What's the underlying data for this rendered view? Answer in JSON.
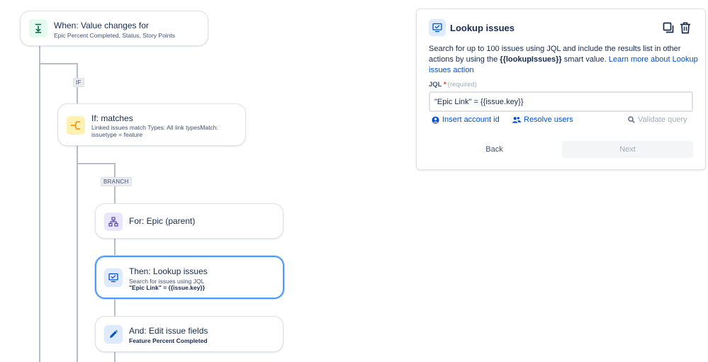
{
  "flow": {
    "trigger": {
      "title": "When: Value changes for",
      "subtitle": "Epic Percent Completed, Status, Story Points",
      "icon": "trigger-down-arrow-icon"
    },
    "if_tag": "IF",
    "condition": {
      "title": "If: matches",
      "subtitle": "Linked issues match Types: All link typesMatch: issuetype = feature",
      "icon": "branch-icon"
    },
    "branch_tag": "BRANCH",
    "branch": {
      "title": "For: Epic (parent)",
      "icon": "hierarchy-icon"
    },
    "lookup": {
      "title": "Then: Lookup issues",
      "subtitle": "Search for issues using JQL",
      "subtitle_bold": "\"Epic Link\" = {{issue.key}}",
      "icon": "lookup-icon"
    },
    "edit": {
      "title": "And: Edit issue fields",
      "subtitle_bold": "Feature Percent Completed",
      "icon": "pencil-icon"
    }
  },
  "panel": {
    "title": "Lookup issues",
    "desc_before": "Search for up to 100 issues using JQL and include the results list in other actions by using the ",
    "desc_smart_value": "{{lookupIssues}}",
    "desc_after": " smart value. ",
    "desc_link": "Learn more about Lookup issues action",
    "jql_label": "JQL",
    "jql_required_mark": "*",
    "jql_hint": "(required)",
    "jql_value": "\"Epic Link\" = {{issue.key}}",
    "insert_account": "Insert account id",
    "resolve_users": "Resolve users",
    "validate_query": "Validate query",
    "back": "Back",
    "next": "Next",
    "copy_icon": "copy-icon",
    "delete_icon": "trash-icon"
  },
  "colors": {
    "accent": "#0052cc",
    "selected_border": "#4c9aff",
    "trigger_icon_bg": "#e3fcef",
    "condition_icon_bg": "#fff0b3",
    "action_icon_bg": "#deebff",
    "branch_icon_bg": "#eae6ff"
  }
}
